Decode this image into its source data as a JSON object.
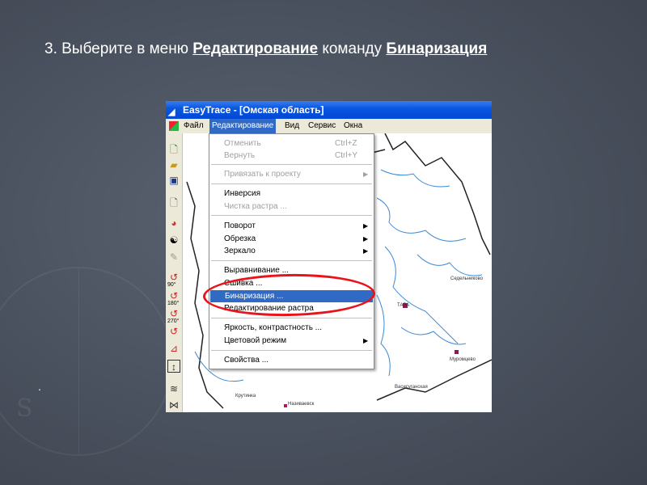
{
  "slide": {
    "step_prefix": "3. Выберите в меню ",
    "menu_name": "Редактирование",
    "middle": " команду ",
    "command_name": "Бинаризация",
    "bullet": "."
  },
  "window": {
    "title": "EasyTrace - [Омская область]"
  },
  "menubar": {
    "items": [
      {
        "label": "Файл"
      },
      {
        "label": "Редактирование"
      },
      {
        "label": "Вид"
      },
      {
        "label": "Сервис"
      },
      {
        "label": "Окна"
      }
    ]
  },
  "toolbar": {
    "icons": [
      {
        "name": "new-file-icon",
        "glyph": "🗋",
        "caption": ""
      },
      {
        "name": "open-folder-icon",
        "glyph": "📂",
        "caption": ""
      },
      {
        "name": "save-icon",
        "glyph": "💾",
        "caption": ""
      },
      {
        "name": "new-raster-icon",
        "glyph": "🗋",
        "caption": ""
      },
      {
        "name": "color-palette-icon",
        "glyph": "◕",
        "caption": ""
      },
      {
        "name": "yin-yang-icon",
        "glyph": "☯",
        "caption": ""
      },
      {
        "name": "disabled-tool-icon",
        "glyph": "✎",
        "caption": ""
      },
      {
        "name": "rotate-90-icon",
        "glyph": "↺",
        "caption": "90°"
      },
      {
        "name": "rotate-180-icon",
        "glyph": "↺",
        "caption": "180°"
      },
      {
        "name": "rotate-270-icon",
        "glyph": "↺",
        "caption": "270°"
      },
      {
        "name": "rotate-free-icon",
        "glyph": "↺",
        "caption": ""
      },
      {
        "name": "angle-icon",
        "glyph": "⊿",
        "caption": ""
      },
      {
        "name": "height-icon",
        "glyph": "↕",
        "caption": ""
      },
      {
        "name": "equalize-icon",
        "glyph": "≋",
        "caption": ""
      },
      {
        "name": "stitch-icon",
        "glyph": "⋈",
        "caption": ""
      }
    ]
  },
  "dropdown": {
    "items": [
      {
        "label": "Отменить",
        "shortcut": "Ctrl+Z",
        "disabled": true
      },
      {
        "label": "Вернуть",
        "shortcut": "Ctrl+Y",
        "disabled": true
      },
      {
        "label": "Привязать к проекту",
        "disabled": true,
        "submenu": true
      },
      {
        "label": "Инверсия"
      },
      {
        "label": "Чистка растра ...",
        "disabled": true
      },
      {
        "label": "Поворот",
        "submenu": true
      },
      {
        "label": "Обрезка",
        "submenu": true
      },
      {
        "label": "Зеркало",
        "submenu": true
      },
      {
        "label": "Выравнивание ..."
      },
      {
        "label": "Сшивка ..."
      },
      {
        "label": "Бинаризация ...",
        "highlighted": true
      },
      {
        "label": "Редактирование растра"
      },
      {
        "label": "Яркость, контрастность ..."
      },
      {
        "label": "Цветовой режим",
        "submenu": true
      },
      {
        "label": "Свойства ..."
      }
    ]
  },
  "map": {
    "labels": [
      {
        "text": "Седельниково"
      },
      {
        "text": "ТАРА"
      },
      {
        "text": "Муромцево"
      },
      {
        "text": "Васисуганская"
      },
      {
        "text": "Крутинка"
      },
      {
        "text": "Називаевск"
      }
    ]
  },
  "colors": {
    "titlebar": "#0a58e0",
    "highlight": "#316ac5",
    "oval": "#e8131b",
    "river": "#3a8ad6",
    "background": "#4a515e"
  }
}
